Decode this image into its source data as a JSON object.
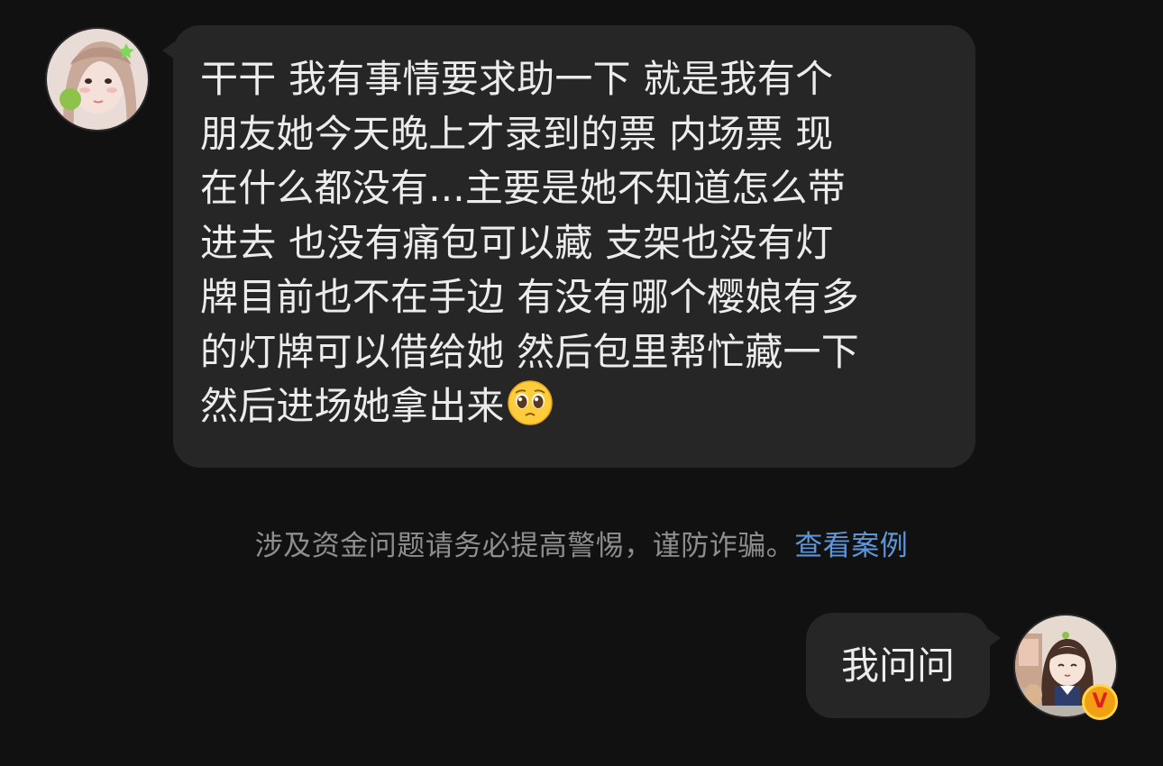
{
  "incoming": {
    "avatar_icon": "female-user-avatar",
    "lines": [
      "干干 我有事情要求助一下 就是我有个",
      "朋友她今天晚上才录到的票 内场票 现",
      "在什么都没有...主要是她不知道怎么带",
      "进去 也没有痛包可以藏 支架也没有灯",
      "牌目前也不在手边 有没有哪个樱娘有多",
      "的灯牌可以借给她 然后包里帮忙藏一下",
      "然后进场她拿出来"
    ],
    "emoji": "pleading-face"
  },
  "notice": {
    "text": "涉及资金问题请务必提高警惕，谨防诈骗。",
    "link": "查看案例"
  },
  "outgoing": {
    "text": "我问问",
    "avatar_icon": "anime-girl-avatar",
    "badge": "V"
  },
  "colors": {
    "background": "#111111",
    "bubble": "#262626",
    "text": "#ececec",
    "notice_text": "#8e8e8e",
    "link": "#5f97d6",
    "badge": "#f2a011"
  }
}
